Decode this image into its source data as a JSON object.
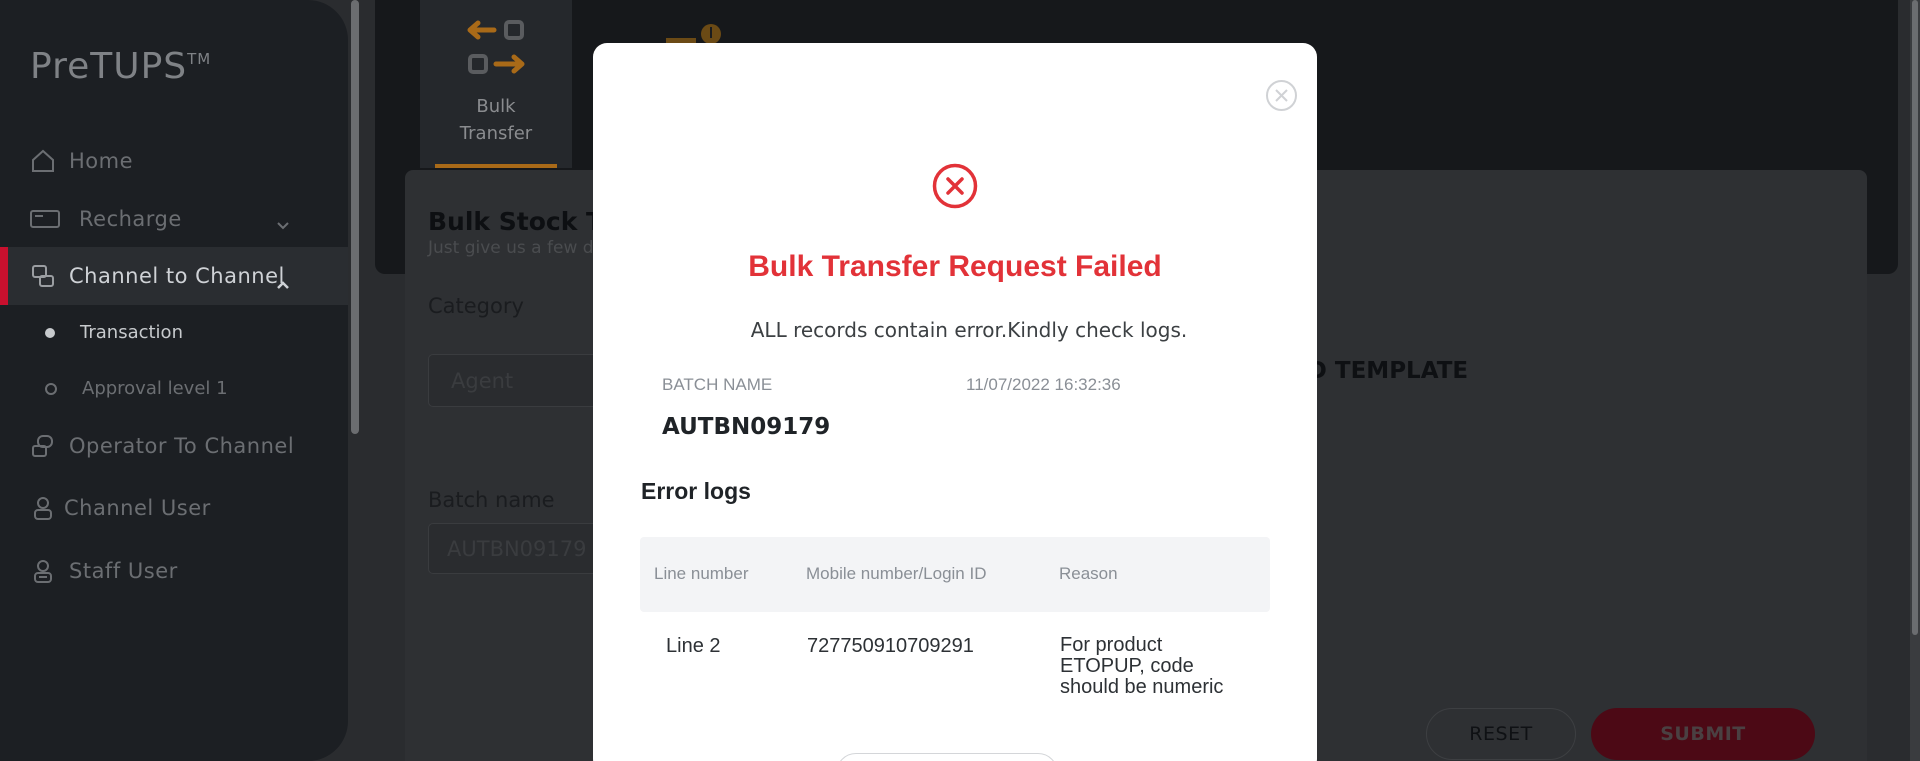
{
  "sidebar": {
    "logo": "PreTUPS",
    "logo_tm": "TM",
    "items": [
      {
        "label": "Home",
        "icon": "home-icon"
      },
      {
        "label": "Recharge",
        "icon": "recharge-icon"
      },
      {
        "label": "Channel to Channel",
        "icon": "channel-icon"
      },
      {
        "label": "Operator To Channel",
        "icon": "operator-icon"
      },
      {
        "label": "Channel User",
        "icon": "user-icon"
      },
      {
        "label": "Staff User",
        "icon": "staff-icon"
      }
    ],
    "subitems": [
      {
        "label": "Transaction"
      },
      {
        "label": "Approval level 1"
      }
    ]
  },
  "tabs": {
    "bulk_transfer": "Bulk Transfer"
  },
  "form": {
    "title": "Bulk Stock Tra",
    "subtitle": "Just give us a few d",
    "category_label": "Category",
    "category_value": "Agent",
    "batch_label": "Batch name",
    "batch_value": "AUTBN09179",
    "template_label": "AD TEMPLATE",
    "reset_label": "RESET",
    "submit_label": "SUBMIT"
  },
  "modal": {
    "title": "Bulk Transfer Request Failed",
    "message": "ALL records contain error.Kindly check logs.",
    "batch_name_label": "BATCH NAME",
    "datetime": "11/07/2022 16:32:36",
    "batch_name": "AUTBN09179",
    "error_logs_label": "Error logs",
    "columns": [
      "Line number",
      "Mobile number/Login ID",
      "Reason"
    ],
    "rows": [
      {
        "line": "Line 2",
        "mobile": "727750910709291",
        "reason": [
          "For product",
          "ETOPUP, code",
          "should be numeric"
        ]
      }
    ]
  },
  "colors": {
    "accent_red": "#e23238",
    "brand_red": "#c8102e",
    "tab_underline": "#a96a18"
  }
}
